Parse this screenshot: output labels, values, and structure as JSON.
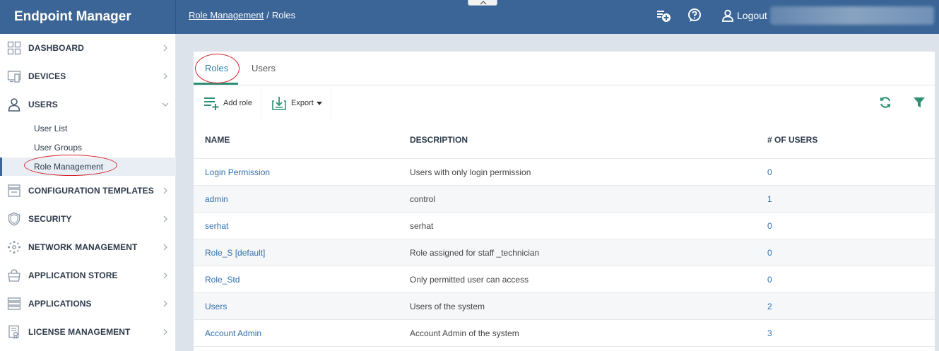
{
  "header": {
    "app_title": "Endpoint Manager",
    "breadcrumb_parent": "Role Management",
    "breadcrumb_separator": "/",
    "breadcrumb_current": "Roles",
    "logout_label": "Logout"
  },
  "sidebar": {
    "items": [
      {
        "label": "DASHBOARD",
        "icon": "dashboard-icon"
      },
      {
        "label": "DEVICES",
        "icon": "devices-icon"
      },
      {
        "label": "USERS",
        "icon": "user-icon",
        "expanded": true
      },
      {
        "label": "CONFIGURATION TEMPLATES",
        "icon": "templates-icon"
      },
      {
        "label": "SECURITY",
        "icon": "shield-icon"
      },
      {
        "label": "NETWORK MANAGEMENT",
        "icon": "network-icon"
      },
      {
        "label": "APPLICATION STORE",
        "icon": "store-icon"
      },
      {
        "label": "APPLICATIONS",
        "icon": "applications-icon"
      },
      {
        "label": "LICENSE MANAGEMENT",
        "icon": "license-icon"
      }
    ],
    "users_subitems": [
      {
        "label": "User List"
      },
      {
        "label": "User Groups"
      },
      {
        "label": "Role Management",
        "active": true
      }
    ]
  },
  "tabs": {
    "roles": "Roles",
    "users": "Users"
  },
  "toolbar": {
    "add_role": "Add role",
    "export": "Export"
  },
  "table": {
    "columns": [
      "NAME",
      "DESCRIPTION",
      "# OF USERS"
    ],
    "rows": [
      {
        "name": "Login Permission",
        "description": "Users with only login permission",
        "count": "0"
      },
      {
        "name": "admin",
        "description": "control",
        "count": "1"
      },
      {
        "name": "serhat",
        "description": "serhat",
        "count": "0"
      },
      {
        "name": "Role_S [default]",
        "description": "Role assigned for staff _technician",
        "count": "0"
      },
      {
        "name": "Role_Std",
        "description": "Only permitted user can access",
        "count": "0"
      },
      {
        "name": "Users",
        "description": "Users of the system",
        "count": "2"
      },
      {
        "name": "Account Admin",
        "description": "Account Admin of the system",
        "count": "3"
      }
    ]
  },
  "colors": {
    "header_bg": "#3a6596",
    "accent_green": "#2e8f73",
    "link_blue": "#2f6fae",
    "highlight_red": "#d6232a"
  }
}
